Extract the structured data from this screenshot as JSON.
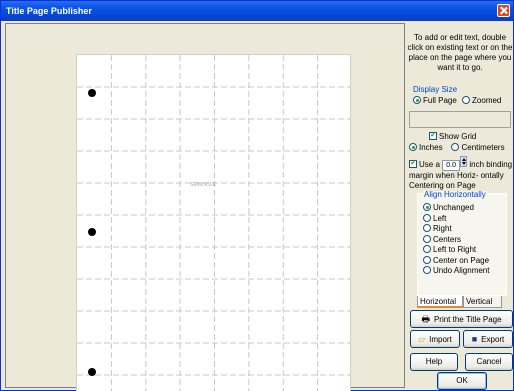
{
  "window": {
    "title": "Title Page Publisher"
  },
  "canvas": {
    "center_text": "SEMINOLE"
  },
  "panel": {
    "instructions": "To add or edit text, double click on existing text or on the place on the page where you want it to go.",
    "display_size": {
      "label": "Display Size",
      "options": [
        "Full Page",
        "Zoomed"
      ],
      "selected": "Full Page"
    },
    "show_grid": {
      "label": "Show Grid",
      "checked": true
    },
    "units": {
      "options": [
        "Inches",
        "Centimeters"
      ],
      "selected": "Inches"
    },
    "binding_margin": {
      "use_label": "Use a",
      "value": "0.0",
      "unit_label": "inch",
      "rest_text": "binding margin when Horiz- ontally Centering on Page",
      "checked": true
    },
    "align": {
      "legend": "Align Horizontally",
      "options": [
        "Unchanged",
        "Left",
        "Right",
        "Centers",
        "Left to Right",
        "Center on Page",
        "Undo Alignment"
      ],
      "selected": "Unchanged"
    },
    "tabs": [
      "Horizontal",
      "Vertical"
    ],
    "active_tab": "Horizontal",
    "buttons": {
      "print": "Print the Title Page",
      "import": "Import",
      "export": "Export",
      "help": "Help",
      "cancel": "Cancel",
      "ok": "OK"
    }
  }
}
